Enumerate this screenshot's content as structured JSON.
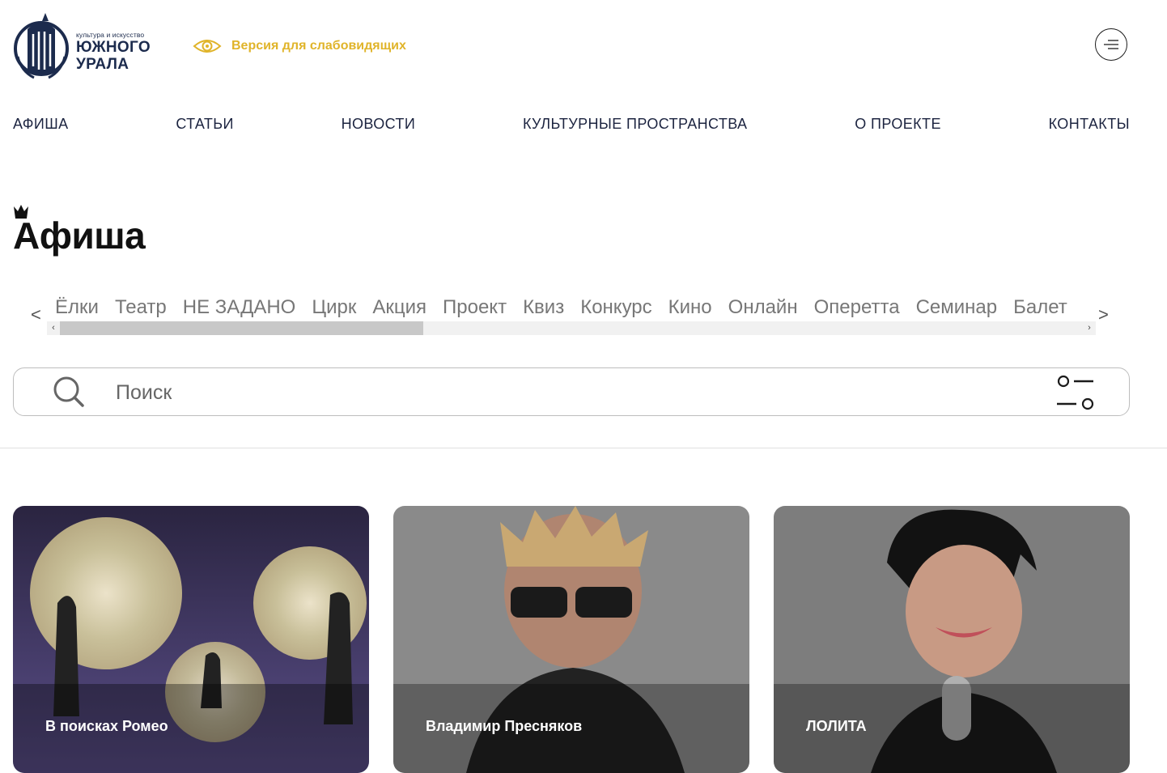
{
  "header": {
    "logo_small": "культура и искусство",
    "logo_line1": "ЮЖНОГО",
    "logo_line2": "УРАЛА",
    "accessibility_label": "Версия для слабовидящих"
  },
  "nav": {
    "items": [
      "АФИША",
      "СТАТЬИ",
      "НОВОСТИ",
      "КУЛЬТУРНЫЕ ПРОСТРАНСТВА",
      "О ПРОЕКТЕ",
      "КОНТАКТЫ"
    ]
  },
  "page_title": "Афиша",
  "categories": {
    "prev": "<",
    "next": ">",
    "items": [
      "Ёлки",
      "Театр",
      "НЕ ЗАДАНО",
      "Цирк",
      "Акция",
      "Проект",
      "Квиз",
      "Конкурс",
      "Кино",
      "Онлайн",
      "Оперетта",
      "Семинар",
      "Балет"
    ]
  },
  "search": {
    "placeholder": "Поиск"
  },
  "cards": [
    {
      "title": "В поисках Ромео"
    },
    {
      "title": "Владимир Пресняков"
    },
    {
      "title": "ЛОЛИТА"
    }
  ],
  "colors": {
    "accent": "#e0b42a",
    "brand": "#1c2b4d"
  }
}
